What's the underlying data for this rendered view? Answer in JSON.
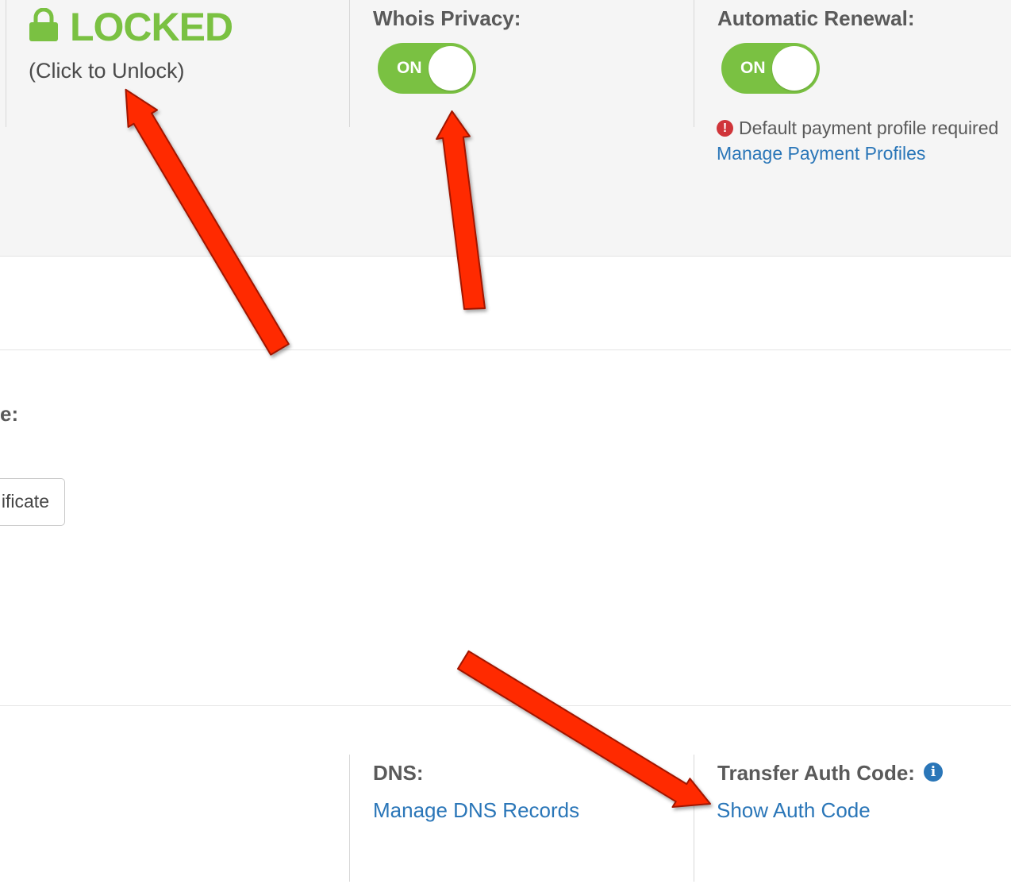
{
  "lock_section": {
    "status": "LOCKED",
    "action": "(Click to Unlock)",
    "icon": "lock-icon"
  },
  "whois_privacy": {
    "label": "Whois Privacy:",
    "toggle_state": "ON"
  },
  "auto_renewal": {
    "label": "Automatic Renewal:",
    "toggle_state": "ON",
    "warning_icon": "!",
    "warning": "Default payment profile required",
    "link": "Manage Payment Profiles"
  },
  "middle_section": {
    "partial_label": "e:",
    "certificate_button": "ificate"
  },
  "dns": {
    "label": "DNS:",
    "link": "Manage DNS Records"
  },
  "transfer": {
    "label": "Transfer Auth Code:",
    "info_icon": "i",
    "link": "Show Auth Code"
  },
  "colors": {
    "accent_green": "#7ac142",
    "link_blue": "#2a76b8",
    "warning_red": "#d0353a",
    "annotation_arrow": "#ff2a00"
  }
}
